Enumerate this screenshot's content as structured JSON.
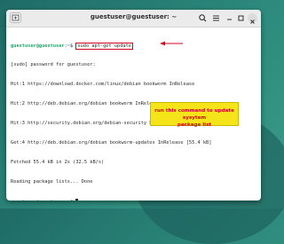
{
  "window": {
    "title": "guestuser@guestuser: ~"
  },
  "terminal": {
    "prompt_user": "guestuser@guestuser",
    "prompt_sep": ":",
    "prompt_path": "~",
    "prompt_symbol": "$ ",
    "command": "sudo apt-get update",
    "output": [
      "[sudo] password for guestuser:",
      "Hit:1 https://download.docker.com/linux/debian bookworm InRelease",
      "Hit:2 http://deb.debian.org/debian bookworm InRelease",
      "Hit:3 http://security.debian.org/debian-security bookworm-security InRelease",
      "Get:4 http://deb.debian.org/debian bookworm-updates InRelease [55.4 kB]",
      "Fetched 55.4 kB in 2s (32.5 kB/s)",
      "Reading package lists... Done"
    ]
  },
  "annotation": {
    "line1": "run this command to update sysytem",
    "line2": "package list"
  },
  "icons": {
    "new_tab": "new-tab-icon",
    "search": "search-icon",
    "menu": "hamburger-menu-icon",
    "minimize": "minimize-icon",
    "maximize": "maximize-icon",
    "close": "close-icon"
  },
  "colors": {
    "prompt_user": "#26a269",
    "prompt_path": "#1c71d8",
    "annotation_bg": "#f6e41a",
    "annotation_text": "#d0021b",
    "highlight_border": "#d0021b"
  }
}
